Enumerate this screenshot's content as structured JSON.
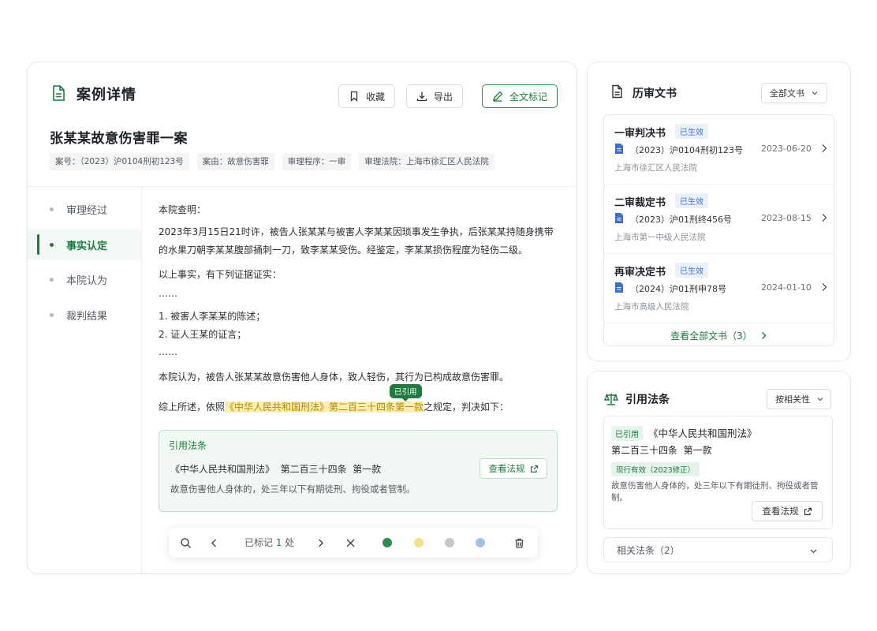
{
  "header": {
    "title": "案例详情",
    "favorite_label": "收藏",
    "export_label": "导出",
    "mark_label": "全文标记"
  },
  "case": {
    "title": "张某某故意伤害罪一案",
    "tags": [
      "案号：（2023）沪0104刑初123号",
      "案由：故意伤害罪",
      "审理程序：一审",
      "审理法院：上海市徐汇区人民法院"
    ]
  },
  "nav": {
    "items": [
      "审理经过",
      "事实认定",
      "本院认为",
      "裁判结果"
    ],
    "active_index": 1
  },
  "content": {
    "lines": [
      "本院查明：",
      "2023年3月15日21时许，被告人张某某与被害人李某某因琐事发生争执，后张某某持随身携带",
      "的水果刀朝李某某腹部捅刺一刀，致李某某受伤。经鉴定，李某某损伤程度为轻伤二级。",
      "以上事实，有下列证据证实：",
      "……",
      "1.   被害人李某某的陈述；",
      "2.   证人王某的证言；",
      "……",
      "本院认为，被告人张某某故意伤害他人身体，致人轻伤，其行为已构成故意伤害罪。"
    ],
    "final_prefix": "综上所述，依照",
    "final_highlight": "《中华人民共和国刑法》第二百三十四条第一款",
    "final_suffix": "之规定，判决如下：",
    "cited_badge": "已引用"
  },
  "cite_box": {
    "label": "引用法条",
    "law": "《中华人民共和国刑法》  第二百三十四条  第一款",
    "description": "故意伤害他人身体的，处三年以下有期徒刑、拘役或者管制。",
    "view_label": "查看法规"
  },
  "toolbar": {
    "status_prefix": "已标记 ",
    "count": "1",
    "status_suffix": " 处",
    "colors": [
      "#2e8b4e",
      "#f5e08c",
      "#c8c8cc",
      "#a6c1e6"
    ]
  },
  "history": {
    "title": "历审文书",
    "filter": "全部文书",
    "docs": [
      {
        "title": "一审判决书",
        "status": "已生效",
        "number": "（2023）沪0104刑初123号",
        "date": "2023-06-20",
        "court": "上海市徐汇区人民法院"
      },
      {
        "title": "二审裁定书",
        "status": "已生效",
        "number": "（2023）沪01刑终456号",
        "date": "2023-08-15",
        "court": "上海市第一中级人民法院"
      },
      {
        "title": "再审决定书",
        "status": "已生效",
        "number": "（2024）沪01刑申78号",
        "date": "2024-01-10",
        "court": "上海市高级人民法院"
      }
    ],
    "view_all": "查看全部文书（3）"
  },
  "laws": {
    "title": "引用法条",
    "sort": "按相关性",
    "cited_badge": "已引用",
    "law_name": "《中华人民共和国刑法》",
    "article": "第二百三十四条  第一款",
    "validity": "现行有效（2023修正）",
    "description": "故意伤害他人身体的，处三年以下有期徒刑、拘役或者管制。",
    "view_label": "查看法规",
    "related": "相关法条（2）"
  }
}
